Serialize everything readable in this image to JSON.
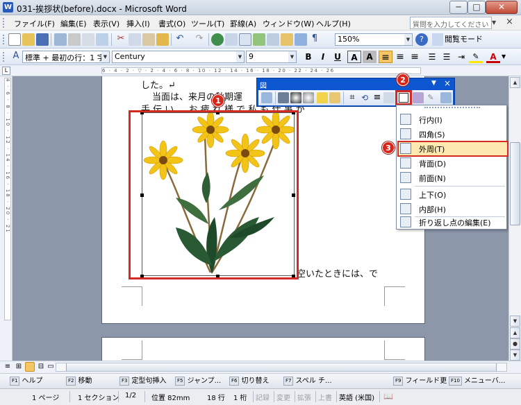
{
  "window": {
    "title": "031-挨拶状(before).docx - Microsoft Word",
    "app_icon": "W",
    "minimize_glyph": "─",
    "maximize_glyph": "□",
    "close_glyph": "✕"
  },
  "menubar": {
    "items": [
      "ファイル(F)",
      "編集(E)",
      "表示(V)",
      "挿入(I)",
      "書式(O)",
      "ツール(T)",
      "罫線(A)",
      "ウィンドウ(W)",
      "ヘルプ(H)"
    ],
    "help_placeholder": "質問を入力してください",
    "doc_close": "×"
  },
  "toolbar_std": {
    "zoom": "150%",
    "reading_mode": "閲覧モード(R)"
  },
  "toolbar_fmt": {
    "style": "標準 + 最初の行：1 字",
    "font": "Century",
    "size": "9",
    "bold": "B",
    "italic": "I",
    "underline": "U",
    "border_char": "A",
    "shade_char": "A",
    "font_color": "A"
  },
  "ruler": {
    "tab_selector": "L",
    "marks": "6 · 4 · 2 · ▽ · 2 · 4 · 6 · 8 · 10 · 12 · 14 · 16 · 18 · 20 · 22 · 24 · 26",
    "vmarks": "4 · 6 · 8 · 10 · 12 · 14 · 16 · 18 · 20 · 21"
  },
  "document": {
    "line1": "した。↵",
    "line2": "当面は、来月の秋期運",
    "line3": "手 伝 い 、 お 疲 れ 様 で    私 も 仕 事 が",
    "line4": "空いたときには、で"
  },
  "picture_toolbar": {
    "title": "図",
    "dropdown": "▼",
    "close": "×"
  },
  "wrap_menu": {
    "items": [
      "行内(I)",
      "四角(S)",
      "外周(T)",
      "背面(D)",
      "前面(N)",
      "上下(O)",
      "内部(H)",
      "折り返し点の編集(E)"
    ]
  },
  "badges": [
    "1",
    "2",
    "3"
  ],
  "fkeys": [
    {
      "num": "F1",
      "label": "ヘルプ"
    },
    {
      "num": "F2",
      "label": "移動"
    },
    {
      "num": "F3",
      "label": "定型句挿入"
    },
    {
      "num": "F5",
      "label": "ジャンプ..."
    },
    {
      "num": "F6",
      "label": "切り替え"
    },
    {
      "num": "F7",
      "label": "スペル チ..."
    },
    {
      "num": "F9",
      "label": "フィールド更"
    },
    {
      "num": "F10",
      "label": "メニューバ..."
    }
  ],
  "status": {
    "page": "1 ページ",
    "section": "1 セクション",
    "pages": "1/2",
    "position": "位置 82mm",
    "line": "18 行",
    "column": "1 桁",
    "rec": "記録",
    "trk": "変更",
    "ext": "拡張",
    "ovr": "上書",
    "lang": "英語 (米国)"
  },
  "colors": {
    "highlight_red": "#d52a22",
    "menu_highlight": "#fde8b0",
    "picture_toolbar_blue": "#0c56d0"
  }
}
